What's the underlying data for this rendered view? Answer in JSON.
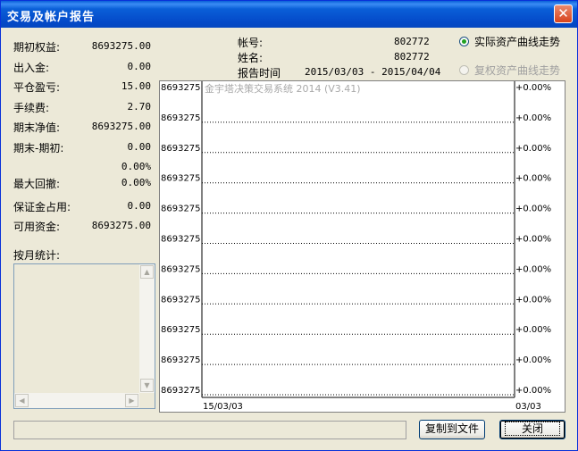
{
  "window": {
    "title": "交易及帐户报告",
    "close_glyph": "✕"
  },
  "stats": [
    {
      "label": "期初权益:",
      "value": "8693275.00"
    },
    {
      "label": "出入金:",
      "value": "0.00"
    },
    {
      "label": "平仓盈亏:",
      "value": "15.00"
    },
    {
      "label": "手续费:",
      "value": "2.70"
    },
    {
      "label": "期末净值:",
      "value": "8693275.00"
    },
    {
      "label": "期末-期初:",
      "value": "0.00"
    },
    {
      "label": "",
      "value": "0.00%"
    },
    {
      "label": "最大回撤:",
      "value": "0.00%"
    },
    {
      "label": "保证金占用:",
      "value": "0.00"
    },
    {
      "label": "可用资金:",
      "value": "8693275.00"
    }
  ],
  "monthly_label": "按月统计:",
  "header": {
    "account_label": "帐号:",
    "account_value": "802772",
    "name_label": "姓名:",
    "name_value": "802772",
    "time_label": "报告时间",
    "time_value": "2015/03/03 - 2015/04/04"
  },
  "radios": [
    {
      "label": "实际资产曲线走势",
      "checked": true,
      "disabled": false
    },
    {
      "label": "复权资产曲线走势",
      "checked": false,
      "disabled": true
    }
  ],
  "chart_data": {
    "type": "line",
    "title": "金宇塔决策交易系统 2014 (V3.41)",
    "left_ticks": [
      "8693275",
      "8693275",
      "8693275",
      "8693275",
      "8693275",
      "8693275",
      "8693275",
      "8693275",
      "8693275",
      "8693275",
      "8693275"
    ],
    "right_ticks": [
      "+0.00%",
      "+0.00%",
      "+0.00%",
      "+0.00%",
      "+0.00%",
      "+0.00%",
      "+0.00%",
      "+0.00%",
      "+0.00%",
      "+0.00%",
      "+0.00%"
    ],
    "x_start": "15/03/03",
    "x_end": "03/03",
    "grid": true,
    "series": []
  },
  "buttons": {
    "copy": "复制到文件",
    "close": "关闭"
  },
  "colors": {
    "title_bar": "#0a5fd8",
    "window_bg": "#ece9d8",
    "close_button": "#d8431c"
  },
  "icons": {
    "close": "close-icon",
    "scroll_up": "arrow-up-icon",
    "scroll_down": "arrow-down-icon",
    "scroll_left": "arrow-left-icon",
    "scroll_right": "arrow-right-icon"
  }
}
